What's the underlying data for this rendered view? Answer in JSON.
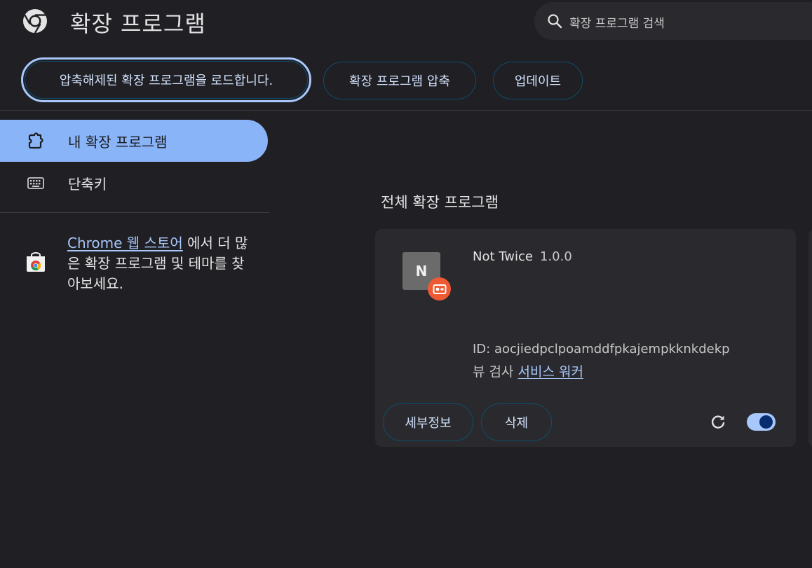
{
  "header": {
    "title": "확장 프로그램",
    "logo_icon": "chrome-logo-icon",
    "search": {
      "icon": "search-icon",
      "placeholder": "확장 프로그램 검색"
    }
  },
  "toolbar": {
    "load_unpacked_label": "압축해제된 확장 프로그램을 로드합니다.",
    "pack_label": "확장 프로그램 압축",
    "update_label": "업데이트"
  },
  "sidebar": {
    "items": [
      {
        "label": "내 확장 프로그램",
        "icon": "extension-puzzle-icon",
        "selected": true
      },
      {
        "label": "단축키",
        "icon": "keyboard-icon",
        "selected": false
      }
    ],
    "store_promo": {
      "icon": "chrome-web-store-icon",
      "link_text": "Chrome 웹 스토어",
      "text": " 에서 더 많은 확장 프로그램 및 테마를 찾아보세요."
    }
  },
  "main": {
    "section_title": "전체 확장 프로그램",
    "extensions": [
      {
        "avatar_letter": "N",
        "badge_icon": "unpacked-source-icon",
        "name": "Not Twice",
        "version": "1.0.0",
        "id_text": "ID: aocjiedpclpoamddfpkajempkknkdekp",
        "inspect_label": "뷰 검사",
        "inspect_link": "서비스 워커",
        "details_label": "세부정보",
        "remove_label": "삭제",
        "reload_icon": "reload-icon",
        "enabled": true
      }
    ]
  },
  "colors": {
    "background": "#1f1f24",
    "card": "#2a2a2e",
    "accent": "#8ab4f8",
    "link": "#a8c7fa",
    "badge": "#ee5a33"
  }
}
